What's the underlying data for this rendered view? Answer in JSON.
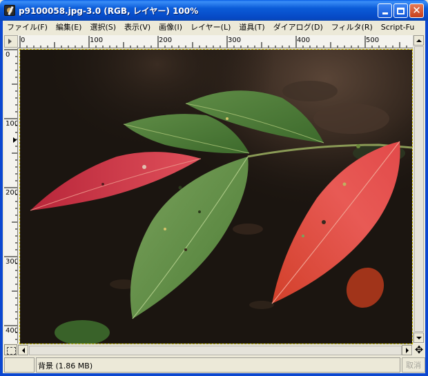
{
  "window": {
    "title": "p9100058.jpg-3.0 (RGB, レイヤー) 100%",
    "icon": "gimp-wilber-icon",
    "buttons": [
      "minimize-icon",
      "maximize-icon",
      "close-icon"
    ]
  },
  "menu": {
    "items": [
      "ファイル(F)",
      "編集(E)",
      "選択(S)",
      "表示(V)",
      "画像(I)",
      "レイヤー(L)",
      "道具(T)",
      "ダイアログ(D)",
      "フィルタ(R)",
      "Script-Fu"
    ]
  },
  "rulers": {
    "horizontal_labels": [
      "0",
      "100",
      "200",
      "300",
      "400",
      "500"
    ],
    "vertical_labels": [
      "0",
      "100",
      "200",
      "300",
      "400"
    ]
  },
  "canvas": {
    "image": "photo of red and green leaves on a dark forest floor"
  },
  "status": {
    "text": "背景 (1.86 MB)",
    "cancel_label": "取消"
  },
  "colors": {
    "title_blue": "#0b5bd8",
    "canvas_dark": "#1b1510",
    "leaf_green": "#4f7a3a",
    "leaf_red": "#d8404a",
    "selection_border": "#d6c800"
  }
}
